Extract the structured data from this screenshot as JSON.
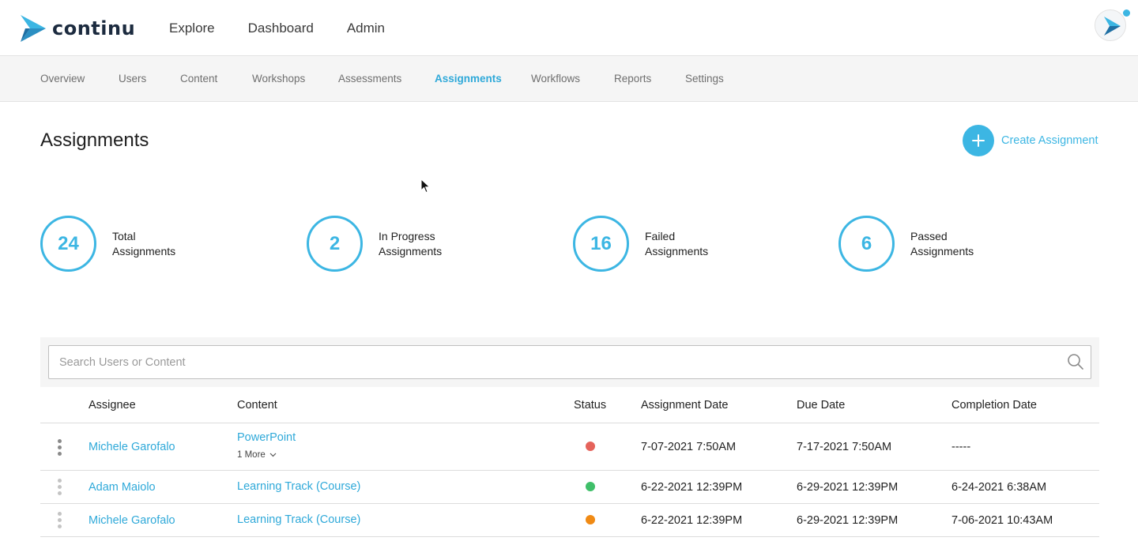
{
  "brand": {
    "name": "continu"
  },
  "topnav": {
    "items": [
      {
        "label": "Explore"
      },
      {
        "label": "Dashboard"
      },
      {
        "label": "Admin"
      }
    ]
  },
  "subnav": {
    "tabs": [
      {
        "label": "Overview",
        "active": false
      },
      {
        "label": "Users",
        "active": false
      },
      {
        "label": "Content",
        "active": false
      },
      {
        "label": "Workshops",
        "active": false
      },
      {
        "label": "Assessments",
        "active": false
      },
      {
        "label": "Assignments",
        "active": true
      },
      {
        "label": "Workflows",
        "active": false
      },
      {
        "label": "Reports",
        "active": false
      },
      {
        "label": "Settings",
        "active": false
      }
    ]
  },
  "page": {
    "title": "Assignments",
    "create_label": "Create Assignment"
  },
  "stats": [
    {
      "value": "24",
      "line1": "Total",
      "line2": "Assignments"
    },
    {
      "value": "2",
      "line1": "In Progress",
      "line2": "Assignments"
    },
    {
      "value": "16",
      "line1": "Failed",
      "line2": "Assignments"
    },
    {
      "value": "6",
      "line1": "Passed",
      "line2": "Assignments"
    }
  ],
  "search": {
    "placeholder": "Search Users or Content",
    "value": ""
  },
  "table": {
    "headers": {
      "assignee": "Assignee",
      "content": "Content",
      "status": "Status",
      "assignment_date": "Assignment Date",
      "due_date": "Due Date",
      "completion_date": "Completion Date"
    },
    "rows": [
      {
        "assignee": "Michele Garofalo",
        "content": "PowerPoint",
        "more": "1 More",
        "status_color": "#e5635b",
        "assignment_date": "7-07-2021 7:50AM",
        "due_date": "7-17-2021 7:50AM",
        "completion_date": "-----"
      },
      {
        "assignee": "Adam Maiolo",
        "content": "Learning Track (Course)",
        "status_color": "#3fbf69",
        "assignment_date": "6-22-2021 12:39PM",
        "due_date": "6-29-2021 12:39PM",
        "completion_date": "6-24-2021 6:38AM"
      },
      {
        "assignee": "Michele Garofalo",
        "content": "Learning Track (Course)",
        "status_color": "#f08a14",
        "assignment_date": "6-22-2021 12:39PM",
        "due_date": "6-29-2021 12:39PM",
        "completion_date": "7-06-2021 10:43AM"
      }
    ]
  },
  "colors": {
    "accent": "#3cb6e3",
    "brand_dark": "#1c2b3f"
  }
}
